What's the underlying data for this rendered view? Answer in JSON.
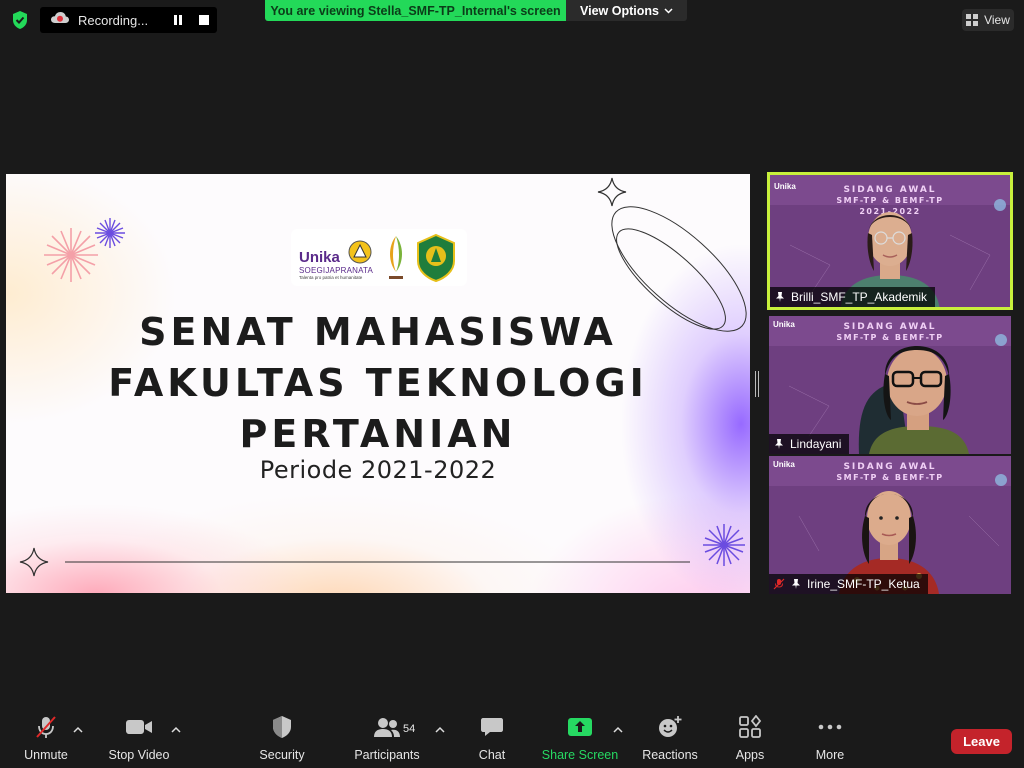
{
  "top_bar": {
    "recording_label": "Recording...",
    "banner_text": "You are viewing Stella_SMF-TP_Internal's screen",
    "view_options_label": "View Options",
    "view_label": "View"
  },
  "slide": {
    "logo_unika": "Unika",
    "logo_soegijapranata": "SOEGIJAPRANATA",
    "logo_tagline": "Talenta pro patria et humanitate",
    "title_line1": "SENAT MAHASISWA",
    "title_line2": "FAKULTAS TEKNOLOGI",
    "title_line3": "PERTANIAN",
    "subtitle": "Periode 2021-2022"
  },
  "participants": [
    {
      "name": "Brilli_SMF_TP_Akademik",
      "active": true
    },
    {
      "name": "Lindayani",
      "active": false
    },
    {
      "name": "Irine_SMF-TP_Ketua",
      "active": false
    }
  ],
  "tile_background": {
    "title_line1": "SIDANG AWAL",
    "title_line2": "SMF-TP & BEMF-TP",
    "year": "2021-2022",
    "logo_text": "Unika"
  },
  "toolbar": {
    "unmute": "Unmute",
    "stop_video": "Stop Video",
    "security": "Security",
    "participants": "Participants",
    "participant_count": "54",
    "chat": "Chat",
    "share_screen": "Share Screen",
    "reactions": "Reactions",
    "apps": "Apps",
    "more": "More",
    "leave": "Leave"
  },
  "colors": {
    "share_green": "#26d962",
    "banner_green": "#23d959",
    "leave_red": "#c4232b",
    "active_border": "#c8f03c"
  }
}
